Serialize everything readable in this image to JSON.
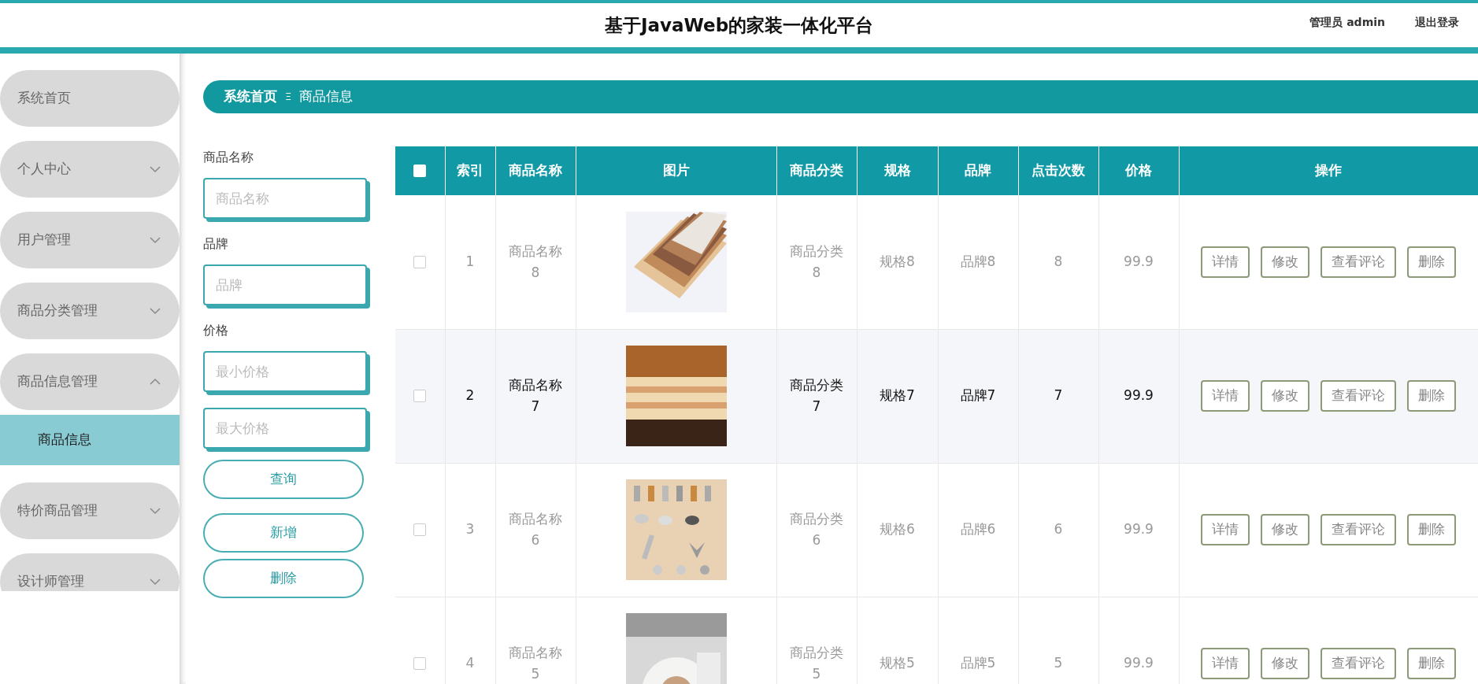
{
  "header": {
    "title": "基于JavaWeb的家装一体化平台",
    "user": "管理员 admin",
    "logout": "退出登录"
  },
  "sidebar": {
    "items": [
      {
        "label": "系统首页"
      },
      {
        "label": "个人中心",
        "expanded": false
      },
      {
        "label": "用户管理",
        "expanded": false
      },
      {
        "label": "商品分类管理",
        "expanded": false
      },
      {
        "label": "商品信息管理",
        "expanded": true,
        "children": [
          {
            "label": "商品信息",
            "selected": true
          }
        ]
      },
      {
        "label": "特价商品管理",
        "expanded": false
      },
      {
        "label": "设计师管理",
        "expanded": false
      }
    ]
  },
  "breadcrumb": {
    "items": [
      "系统首页",
      "商品信息"
    ],
    "separator": "Ξ"
  },
  "filters": [
    {
      "label": "商品名称",
      "inputs": [
        {
          "placeholder": "商品名称"
        }
      ]
    },
    {
      "label": "品牌",
      "inputs": [
        {
          "placeholder": "品牌"
        }
      ]
    },
    {
      "label": "价格",
      "inputs": [
        {
          "placeholder": "最小价格"
        },
        {
          "placeholder": "最大价格"
        }
      ]
    }
  ],
  "filter_buttons": [
    "查询",
    "新增",
    "删除"
  ],
  "table": {
    "select_all": {
      "checked": false
    },
    "columns": [
      "索引",
      "商品名称",
      "图片",
      "商品分类",
      "规格",
      "品牌",
      "点击次数",
      "价格",
      "操作"
    ],
    "rows": [
      {
        "checked": false,
        "hovered": false,
        "index": "1",
        "name": "商品名称8",
        "category": "商品分类8",
        "spec": "规格8",
        "brand": "品牌8",
        "clicks": "8",
        "price": "99.9",
        "actions": [
          "详情",
          "修改",
          "查看评论",
          "删除"
        ]
      },
      {
        "checked": false,
        "hovered": true,
        "index": "2",
        "name": "商品名称7",
        "category": "商品分类7",
        "spec": "规格7",
        "brand": "品牌7",
        "clicks": "7",
        "price": "99.9",
        "actions": [
          "详情",
          "修改",
          "查看评论",
          "删除"
        ]
      },
      {
        "checked": false,
        "hovered": false,
        "index": "3",
        "name": "商品名称6",
        "category": "商品分类6",
        "spec": "规格6",
        "brand": "品牌6",
        "clicks": "6",
        "price": "99.9",
        "actions": [
          "详情",
          "修改",
          "查看评论",
          "删除"
        ]
      },
      {
        "checked": false,
        "hovered": false,
        "index": "4",
        "name": "商品名称5",
        "category": "商品分类5",
        "spec": "规格5",
        "brand": "品牌5",
        "clicks": "5",
        "price": "99.9",
        "actions": [
          "详情",
          "修改",
          "查看评论",
          "删除"
        ]
      }
    ]
  }
}
